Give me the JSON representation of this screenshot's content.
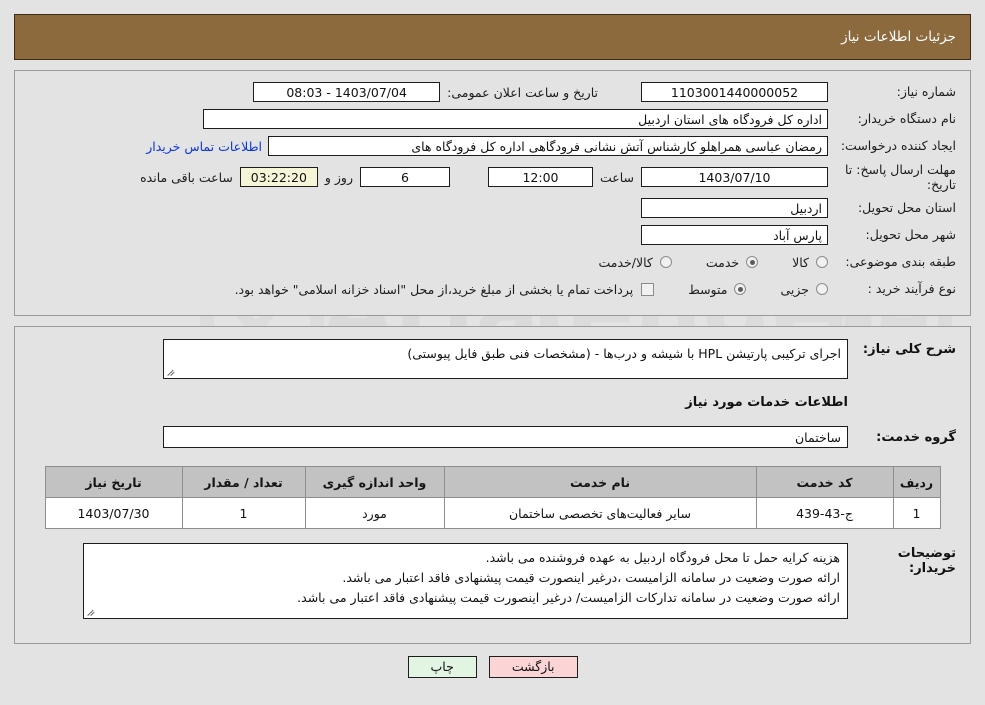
{
  "header": {
    "title": "جزئیات اطلاعات نیاز",
    "bar_color": "#8c6a3e"
  },
  "top_form": {
    "need_number_label": "شماره نیاز:",
    "need_number_value": "1103001440000052",
    "public_announce_label": "تاریخ و ساعت اعلان عمومی:",
    "public_announce_value": "1403/07/04 - 08:03",
    "buyer_org_label": "نام دستگاه خریدار:",
    "buyer_org_value": "اداره کل فرودگاه های استان اردبیل",
    "requester_label": "ایجاد کننده درخواست:",
    "requester_value": "رمضان عباسی همراهلو  کارشناس آتش نشانی فرودگاهی اداره کل فرودگاه های",
    "buyer_contact_link": "اطلاعات تماس خریدار",
    "deadline_label": "مهلت ارسال پاسخ: تا تاریخ:",
    "deadline_date": "1403/07/10",
    "hour_label": "ساعت",
    "deadline_time": "12:00",
    "days_value": "6",
    "days_and_label": "روز و",
    "countdown_value": "03:22:20",
    "remaining_label": "ساعت باقی مانده",
    "province_label": "استان محل تحویل:",
    "province_value": "اردبیل",
    "city_label": "شهر محل تحویل:",
    "city_value": "پارس آباد",
    "category_label": "طبقه بندی موضوعی:",
    "category_options": [
      {
        "label": "کالا",
        "selected": false
      },
      {
        "label": "خدمت",
        "selected": true
      },
      {
        "label": "کالا/خدمت",
        "selected": false
      }
    ],
    "process_label": "نوع فرآیند خرید :",
    "process_options": [
      {
        "label": "جزیی",
        "selected": false
      },
      {
        "label": "متوسط",
        "selected": true
      }
    ],
    "treasury_checkbox_text": "پرداخت تمام یا بخشی از مبلغ خرید،از محل \"اسناد خزانه اسلامی\" خواهد بود.",
    "treasury_checked": false
  },
  "description": {
    "need_summary_label": "شرح کلی نیاز:",
    "need_summary_value": "اجرای ترکیبی پارتیشن HPL با شیشه و درب‌ها - (مشخصات فنی طبق فایل پیوستی)",
    "services_section_title": "اطلاعات خدمات مورد نیاز",
    "service_group_label": "گروه خدمت:",
    "service_group_value": "ساختمان"
  },
  "items_table": {
    "columns": [
      "ردیف",
      "کد خدمت",
      "نام خدمت",
      "واحد اندازه گیری",
      "تعداد / مقدار",
      "تاریخ نیاز"
    ],
    "rows": [
      {
        "radif": "1",
        "code": "ج-43-439",
        "name": "سایر فعالیت‌های تخصصی ساختمان",
        "unit": "مورد",
        "qty": "1",
        "need_date": "1403/07/30"
      }
    ]
  },
  "buyer_notes": {
    "label": "توضیحات خریدار:",
    "lines": [
      "هزینه کرایه حمل تا محل فرودگاه اردبیل به عهده فروشنده می باشد.",
      "ارائه صورت وضعیت در سامانه الزامیست ،درغیر اینصورت قیمت پیشنهادی فاقد اعتبار می باشد.",
      "ارائه صورت وضعیت در سامانه تدارکات الزامیست/ درغیر اینصورت قیمت پیشنهادی فاقد اعتبار می باشد."
    ]
  },
  "footer": {
    "back_label": "بازگشت",
    "print_label": "چاپ"
  },
  "watermark": {
    "text": "AriaTender.net"
  }
}
